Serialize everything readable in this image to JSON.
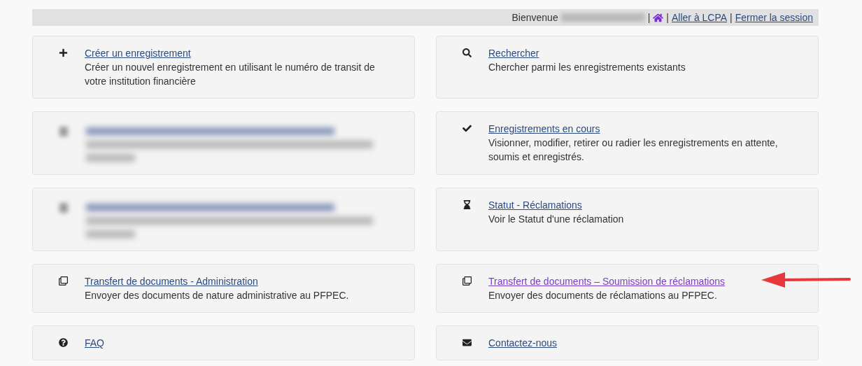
{
  "header": {
    "greeting": "Bienvenue",
    "user_name_blurred": true,
    "separator": "|",
    "links": [
      {
        "label": "Aller à LCPA"
      },
      {
        "label": "Fermer la session"
      }
    ]
  },
  "cards": [
    {
      "kind": "link",
      "title": "Créer un enregistrement",
      "description": "Créer un nouvel enregistrement en utilisant le numéro de transit de votre institution financière",
      "visited": false,
      "highlighted": false
    },
    {
      "kind": "link",
      "title": "Rechercher",
      "description": "Chercher parmi les enregistrements existants",
      "visited": false,
      "highlighted": false
    },
    {
      "kind": "blurred"
    },
    {
      "kind": "link",
      "title": "Enregistrements en cours",
      "description": "Visionner, modifier, retirer ou radier les enregistrements en attente, soumis et enregistrés.",
      "visited": false,
      "highlighted": false
    },
    {
      "kind": "blurred"
    },
    {
      "kind": "link",
      "title": "Statut - Réclamations",
      "description": "Voir le Statut d'une réclamation",
      "visited": false,
      "highlighted": false
    },
    {
      "kind": "link",
      "title": "Transfert de documents - Administration",
      "description": "Envoyer des documents de nature administrative au PFPEC.",
      "visited": false,
      "highlighted": false
    },
    {
      "kind": "link",
      "title": "Transfert de documents – Soumission de réclamations",
      "description": "Envoyer des documents de réclamations au PFPEC.",
      "visited": true,
      "highlighted": true
    },
    {
      "kind": "link",
      "title": "FAQ",
      "visited": false,
      "highlighted": false
    },
    {
      "kind": "link",
      "title": "Contactez-nous",
      "visited": false,
      "highlighted": false
    }
  ]
}
